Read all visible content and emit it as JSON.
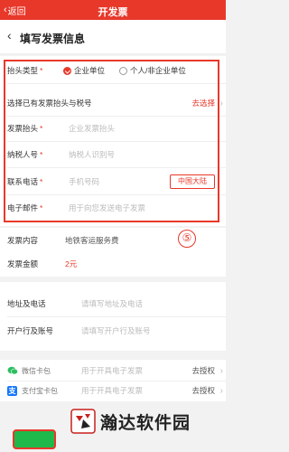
{
  "topbar": {
    "back_label": "返回",
    "title": "开发票"
  },
  "subheader": {
    "title": "填写发票信息"
  },
  "invoice_form": {
    "header_type_label": "抬头类型",
    "option_company": "企业单位",
    "option_personal": "个人/非企业单位",
    "selected_option": "企业单位",
    "select_existing_label": "选择已有发票抬头与税号",
    "select_existing_link": "去选择",
    "title_label": "发票抬头",
    "title_placeholder": "企业发票抬头",
    "taxpayer_label": "纳税人号",
    "taxpayer_placeholder": "纳税人识别号",
    "phone_label": "联系电话",
    "phone_placeholder": "手机号码",
    "region_button": "中国大陆",
    "email_label": "电子邮件",
    "email_placeholder": "用于向您发送电子发票",
    "required_mark": "*"
  },
  "annotation": {
    "marker": "⑤"
  },
  "content": {
    "content_label": "发票内容",
    "content_value": "地铁客运服务费",
    "amount_label": "发票金额",
    "amount_value": "2元"
  },
  "extra": {
    "address_label": "地址及电话",
    "address_placeholder": "请填写地址及电话",
    "bank_label": "开户行及账号",
    "bank_placeholder": "请填写开户行及账号"
  },
  "card_packages": {
    "wechat_label": "微信卡包",
    "wechat_placeholder": "用于开具电子发票",
    "wechat_link": "去授权",
    "alipay_label": "支付宝卡包",
    "alipay_placeholder": "用于开具电子发票",
    "alipay_link": "去授权"
  },
  "watermark": {
    "text": "瀚达软件园"
  },
  "colors": {
    "brand_red": "#e8382a",
    "wechat_green": "#2dbe60",
    "alipay_blue": "#1677ff",
    "button_green": "#1fb84a"
  }
}
